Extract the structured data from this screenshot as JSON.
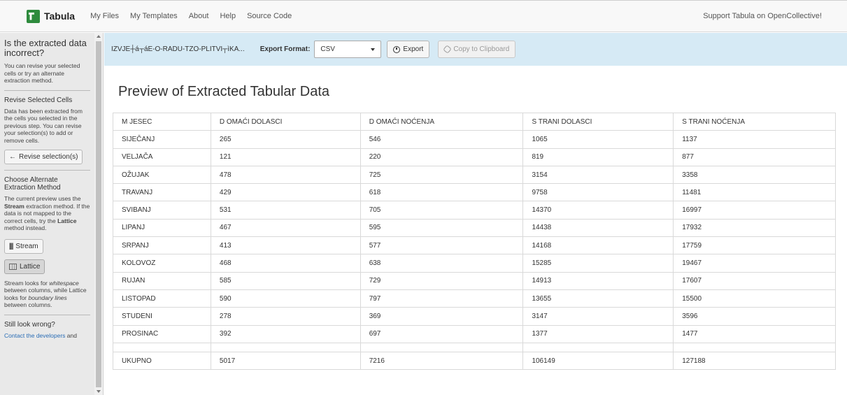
{
  "nav": {
    "brand": "Tabula",
    "links": [
      "My Files",
      "My Templates",
      "About",
      "Help",
      "Source Code"
    ],
    "right": "Support Tabula on OpenCollective!"
  },
  "sidebar": {
    "title": "Is the extracted data incorrect?",
    "intro": "You can revise your selected cells or try an alternate extraction method.",
    "revise_heading": "Revise Selected Cells",
    "revise_text": "Data has been extracted from the cells you selected in the previous step. You can revise your selection(s) to add or remove cells.",
    "revise_button": "Revise selection(s)",
    "method_heading": "Choose Alternate Extraction Method",
    "method_text_1": "The current preview uses the ",
    "method_text_stream": "Stream",
    "method_text_2": " extraction method. If the data is not mapped to the correct cells, try the ",
    "method_text_lattice": "Lattice",
    "method_text_3": " method instead.",
    "stream_button": "Stream",
    "lattice_button": "Lattice",
    "compare_1": "Stream looks for ",
    "compare_whitespace": "whitespace",
    "compare_2": " between columns, while Lattice looks for ",
    "compare_boundary": "boundary lines",
    "compare_3": " between columns.",
    "still_heading": "Still look wrong?",
    "contact_link": "Contact the developers",
    "contact_text": " and"
  },
  "toolbar": {
    "file_name": "IZVJE┼á┬áE-O-RADU-TZO-PLITVI┬ìKA...",
    "export_label": "Export Format:",
    "format_selected": "CSV",
    "export_button": "Export",
    "copy_button": "Copy to Clipboard"
  },
  "main": {
    "title": "Preview of Extracted Tabular Data",
    "headers": [
      "M JESEC",
      "D OMAĆI DOLASCI",
      "D OMAĆI NOĆENJA",
      "S TRANI DOLASCI",
      "S TRANI NOĆENJA"
    ],
    "rows": [
      [
        "SIJEČANJ",
        "265",
        "546",
        "1065",
        "1137"
      ],
      [
        "VELJAČA",
        "121",
        "220",
        "819",
        "877"
      ],
      [
        "OŽUJAK",
        "478",
        "725",
        "3154",
        "3358"
      ],
      [
        "TRAVANJ",
        "429",
        "618",
        "9758",
        "11481"
      ],
      [
        "SVIBANJ",
        "531",
        "705",
        "14370",
        "16997"
      ],
      [
        "LIPANJ",
        "467",
        "595",
        "14438",
        "17932"
      ],
      [
        "SRPANJ",
        "413",
        "577",
        "14168",
        "17759"
      ],
      [
        "KOLOVOZ",
        "468",
        "638",
        "15285",
        "19467"
      ],
      [
        "RUJAN",
        "585",
        "729",
        "14913",
        "17607"
      ],
      [
        "LISTOPAD",
        "590",
        "797",
        "13655",
        "15500"
      ],
      [
        "STUDENI",
        "278",
        "369",
        "3147",
        "3596"
      ],
      [
        "PROSINAC",
        "392",
        "697",
        "1377",
        "1477"
      ],
      [
        "",
        "",
        "",
        "",
        ""
      ],
      [
        "UKUPNO",
        "5017",
        "7216",
        "106149",
        "127188"
      ]
    ]
  }
}
